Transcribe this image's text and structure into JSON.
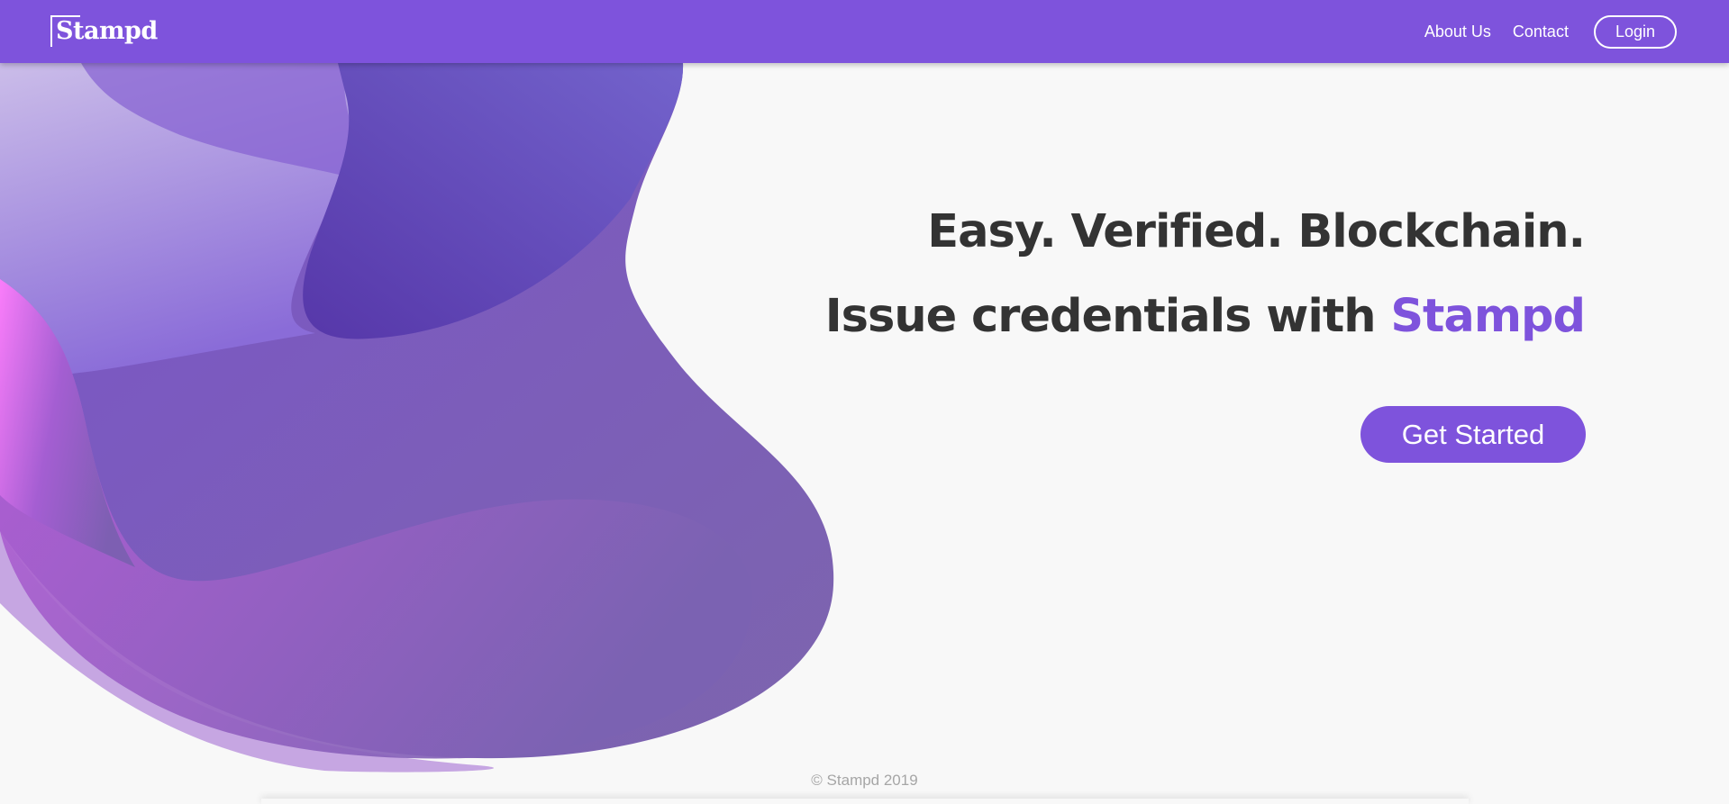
{
  "nav": {
    "brand": "Stampd",
    "links": [
      "About Us",
      "Contact"
    ],
    "login": "Login"
  },
  "hero": {
    "headline": "Easy. Verified. Blockchain.",
    "subheadline_prefix": "Issue credentials with ",
    "subheadline_brand": "Stampd",
    "cta": "Get Started"
  },
  "footer": {
    "copyright": "© Stampd 2019"
  },
  "colors": {
    "brand": "#7e53dc",
    "heading": "#333333",
    "background": "#f8f8f8",
    "footer_text": "#a6a6a6"
  }
}
